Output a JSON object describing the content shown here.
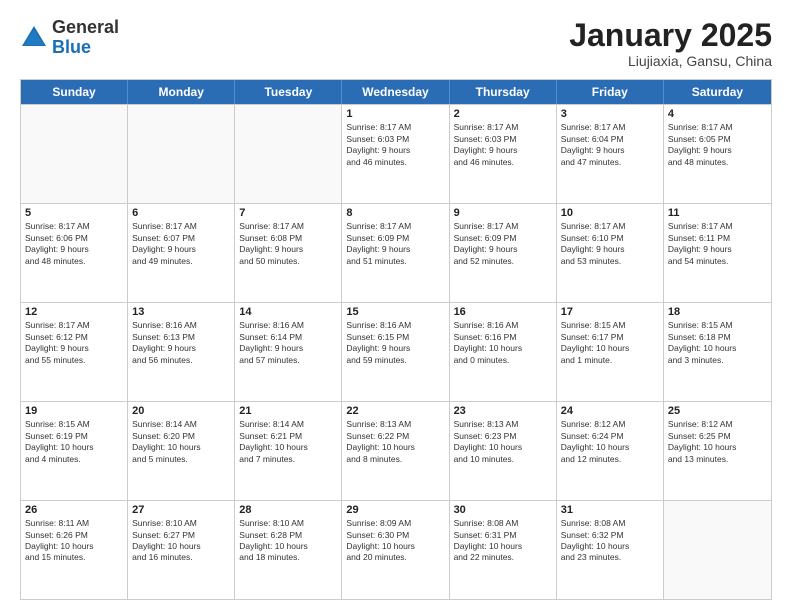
{
  "header": {
    "logo": {
      "general": "General",
      "blue": "Blue"
    },
    "title": "January 2025",
    "subtitle": "Liujiaxia, Gansu, China"
  },
  "weekdays": [
    "Sunday",
    "Monday",
    "Tuesday",
    "Wednesday",
    "Thursday",
    "Friday",
    "Saturday"
  ],
  "rows": [
    [
      {
        "day": "",
        "info": ""
      },
      {
        "day": "",
        "info": ""
      },
      {
        "day": "",
        "info": ""
      },
      {
        "day": "1",
        "info": "Sunrise: 8:17 AM\nSunset: 6:03 PM\nDaylight: 9 hours\nand 46 minutes."
      },
      {
        "day": "2",
        "info": "Sunrise: 8:17 AM\nSunset: 6:03 PM\nDaylight: 9 hours\nand 46 minutes."
      },
      {
        "day": "3",
        "info": "Sunrise: 8:17 AM\nSunset: 6:04 PM\nDaylight: 9 hours\nand 47 minutes."
      },
      {
        "day": "4",
        "info": "Sunrise: 8:17 AM\nSunset: 6:05 PM\nDaylight: 9 hours\nand 48 minutes."
      }
    ],
    [
      {
        "day": "5",
        "info": "Sunrise: 8:17 AM\nSunset: 6:06 PM\nDaylight: 9 hours\nand 48 minutes."
      },
      {
        "day": "6",
        "info": "Sunrise: 8:17 AM\nSunset: 6:07 PM\nDaylight: 9 hours\nand 49 minutes."
      },
      {
        "day": "7",
        "info": "Sunrise: 8:17 AM\nSunset: 6:08 PM\nDaylight: 9 hours\nand 50 minutes."
      },
      {
        "day": "8",
        "info": "Sunrise: 8:17 AM\nSunset: 6:09 PM\nDaylight: 9 hours\nand 51 minutes."
      },
      {
        "day": "9",
        "info": "Sunrise: 8:17 AM\nSunset: 6:09 PM\nDaylight: 9 hours\nand 52 minutes."
      },
      {
        "day": "10",
        "info": "Sunrise: 8:17 AM\nSunset: 6:10 PM\nDaylight: 9 hours\nand 53 minutes."
      },
      {
        "day": "11",
        "info": "Sunrise: 8:17 AM\nSunset: 6:11 PM\nDaylight: 9 hours\nand 54 minutes."
      }
    ],
    [
      {
        "day": "12",
        "info": "Sunrise: 8:17 AM\nSunset: 6:12 PM\nDaylight: 9 hours\nand 55 minutes."
      },
      {
        "day": "13",
        "info": "Sunrise: 8:16 AM\nSunset: 6:13 PM\nDaylight: 9 hours\nand 56 minutes."
      },
      {
        "day": "14",
        "info": "Sunrise: 8:16 AM\nSunset: 6:14 PM\nDaylight: 9 hours\nand 57 minutes."
      },
      {
        "day": "15",
        "info": "Sunrise: 8:16 AM\nSunset: 6:15 PM\nDaylight: 9 hours\nand 59 minutes."
      },
      {
        "day": "16",
        "info": "Sunrise: 8:16 AM\nSunset: 6:16 PM\nDaylight: 10 hours\nand 0 minutes."
      },
      {
        "day": "17",
        "info": "Sunrise: 8:15 AM\nSunset: 6:17 PM\nDaylight: 10 hours\nand 1 minute."
      },
      {
        "day": "18",
        "info": "Sunrise: 8:15 AM\nSunset: 6:18 PM\nDaylight: 10 hours\nand 3 minutes."
      }
    ],
    [
      {
        "day": "19",
        "info": "Sunrise: 8:15 AM\nSunset: 6:19 PM\nDaylight: 10 hours\nand 4 minutes."
      },
      {
        "day": "20",
        "info": "Sunrise: 8:14 AM\nSunset: 6:20 PM\nDaylight: 10 hours\nand 5 minutes."
      },
      {
        "day": "21",
        "info": "Sunrise: 8:14 AM\nSunset: 6:21 PM\nDaylight: 10 hours\nand 7 minutes."
      },
      {
        "day": "22",
        "info": "Sunrise: 8:13 AM\nSunset: 6:22 PM\nDaylight: 10 hours\nand 8 minutes."
      },
      {
        "day": "23",
        "info": "Sunrise: 8:13 AM\nSunset: 6:23 PM\nDaylight: 10 hours\nand 10 minutes."
      },
      {
        "day": "24",
        "info": "Sunrise: 8:12 AM\nSunset: 6:24 PM\nDaylight: 10 hours\nand 12 minutes."
      },
      {
        "day": "25",
        "info": "Sunrise: 8:12 AM\nSunset: 6:25 PM\nDaylight: 10 hours\nand 13 minutes."
      }
    ],
    [
      {
        "day": "26",
        "info": "Sunrise: 8:11 AM\nSunset: 6:26 PM\nDaylight: 10 hours\nand 15 minutes."
      },
      {
        "day": "27",
        "info": "Sunrise: 8:10 AM\nSunset: 6:27 PM\nDaylight: 10 hours\nand 16 minutes."
      },
      {
        "day": "28",
        "info": "Sunrise: 8:10 AM\nSunset: 6:28 PM\nDaylight: 10 hours\nand 18 minutes."
      },
      {
        "day": "29",
        "info": "Sunrise: 8:09 AM\nSunset: 6:30 PM\nDaylight: 10 hours\nand 20 minutes."
      },
      {
        "day": "30",
        "info": "Sunrise: 8:08 AM\nSunset: 6:31 PM\nDaylight: 10 hours\nand 22 minutes."
      },
      {
        "day": "31",
        "info": "Sunrise: 8:08 AM\nSunset: 6:32 PM\nDaylight: 10 hours\nand 23 minutes."
      },
      {
        "day": "",
        "info": ""
      }
    ]
  ]
}
